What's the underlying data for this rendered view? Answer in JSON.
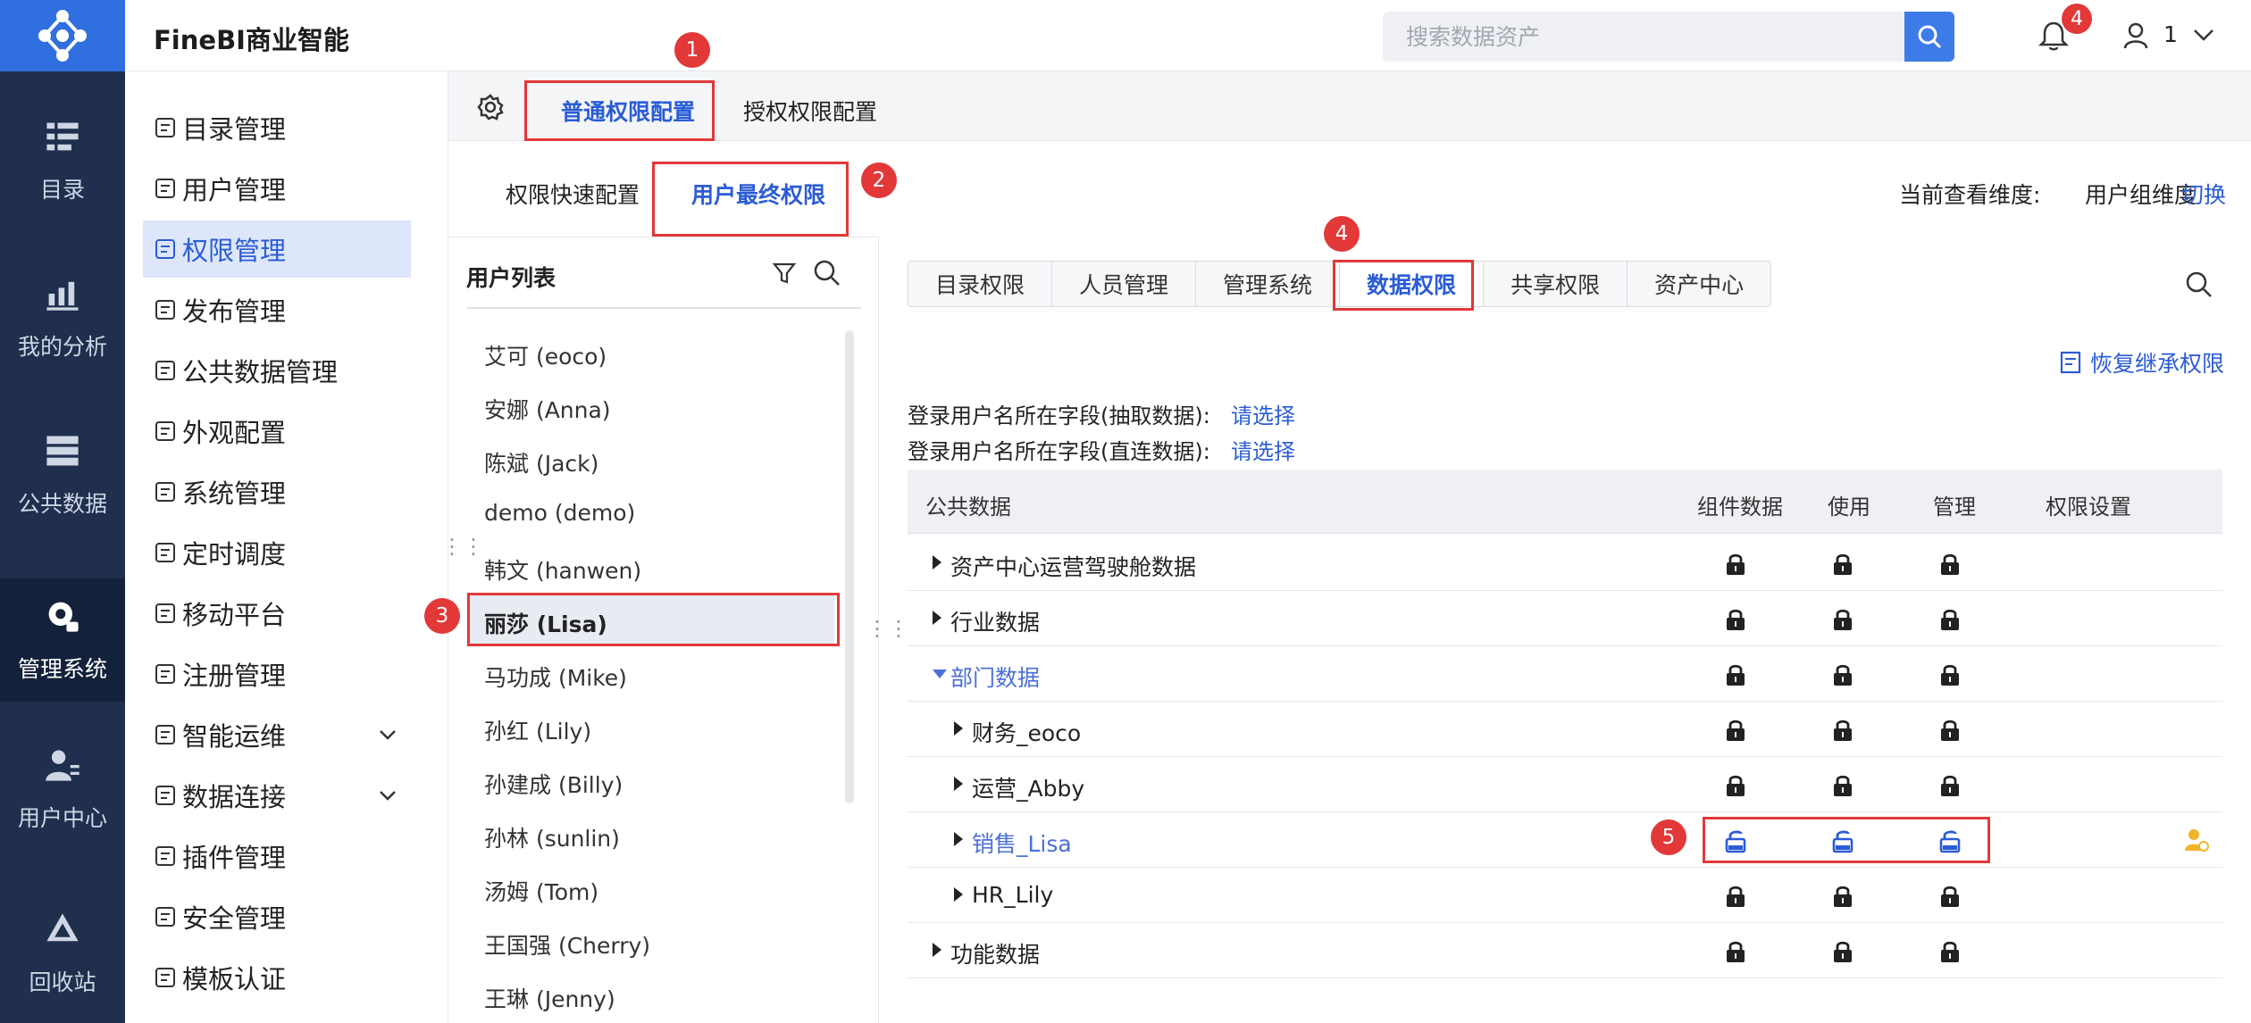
{
  "app": {
    "brand": "FineBI商业智能"
  },
  "rail": [
    {
      "label": "目录",
      "icon": "catalog-icon"
    },
    {
      "label": "我的分析",
      "icon": "analysis-icon"
    },
    {
      "label": "公共数据",
      "icon": "public-data-icon"
    },
    {
      "label": "管理系统",
      "icon": "management-icon",
      "active": true
    },
    {
      "label": "用户中心",
      "icon": "user-center-icon"
    },
    {
      "label": "回收站",
      "icon": "recycle-icon"
    }
  ],
  "topbar": {
    "search_placeholder": "搜索数据资产",
    "notification_count": "4",
    "user_name": "1"
  },
  "menu": [
    {
      "label": "目录管理"
    },
    {
      "label": "用户管理"
    },
    {
      "label": "权限管理",
      "active": true
    },
    {
      "label": "发布管理"
    },
    {
      "label": "公共数据管理"
    },
    {
      "label": "外观配置"
    },
    {
      "label": "系统管理"
    },
    {
      "label": "定时调度"
    },
    {
      "label": "移动平台"
    },
    {
      "label": "注册管理"
    },
    {
      "label": "智能运维",
      "expandable": true
    },
    {
      "label": "数据连接",
      "expandable": true
    },
    {
      "label": "插件管理"
    },
    {
      "label": "安全管理"
    },
    {
      "label": "模板认证"
    }
  ],
  "top_tabs": {
    "general": "普通权限配置",
    "authorize": "授权权限配置"
  },
  "sub_tabs": {
    "quick": "权限快速配置",
    "final": "用户最终权限"
  },
  "dimension": {
    "label": "当前查看维度:",
    "value": "用户组维度",
    "switch": "切换"
  },
  "user_list": {
    "title": "用户列表",
    "users": [
      "艾可 (eoco)",
      "安娜 (Anna)",
      "陈斌 (Jack)",
      "demo (demo)",
      "韩文 (hanwen)",
      "丽莎 (Lisa)",
      "马功成 (Mike)",
      "孙红 (Lily)",
      "孙建成 (Billy)",
      "孙林 (sunlin)",
      "汤姆 (Tom)",
      "王国强 (Cherry)",
      "王琳 (Jenny)"
    ],
    "selected_index": 5
  },
  "perm_tabs": [
    "目录权限",
    "人员管理",
    "管理系统",
    "数据权限",
    "共享权限",
    "资产中心"
  ],
  "restore_label": "恢复继承权限",
  "fields": [
    {
      "label": "登录用户名所在字段(抽取数据):",
      "value": "请选择"
    },
    {
      "label": "登录用户名所在字段(直连数据):",
      "value": "请选择"
    }
  ],
  "table": {
    "headers": [
      "公共数据",
      "组件数据",
      "使用",
      "管理",
      "权限设置"
    ],
    "rows": [
      {
        "name": "资产中心运营驾驶舱数据",
        "level": 0,
        "expanded": false,
        "locks": [
          "locked",
          "locked",
          "locked"
        ]
      },
      {
        "name": "行业数据",
        "level": 0,
        "expanded": false,
        "locks": [
          "locked",
          "locked",
          "locked"
        ]
      },
      {
        "name": "部门数据",
        "level": 0,
        "expanded": true,
        "highlight": true,
        "locks": [
          "locked",
          "locked",
          "locked"
        ]
      },
      {
        "name": "财务_eoco",
        "level": 1,
        "expanded": false,
        "locks": [
          "locked",
          "locked",
          "locked"
        ]
      },
      {
        "name": "运营_Abby",
        "level": 1,
        "expanded": false,
        "locks": [
          "locked",
          "locked",
          "locked"
        ]
      },
      {
        "name": "销售_Lisa",
        "level": 1,
        "expanded": false,
        "highlight": true,
        "locks": [
          "unlocked",
          "unlocked",
          "unlocked"
        ],
        "setting_icon": true
      },
      {
        "name": "HR_Lily",
        "level": 1,
        "expanded": false,
        "locks": [
          "locked",
          "locked",
          "locked"
        ]
      },
      {
        "name": "功能数据",
        "level": 0,
        "expanded": false,
        "locks": [
          "locked",
          "locked",
          "locked"
        ]
      }
    ]
  },
  "annotations": [
    "1",
    "2",
    "3",
    "4",
    "5"
  ],
  "colors": {
    "rail_bg": "#1f2f4d",
    "accent": "#2b5cd6",
    "annotation_red": "#e23838"
  }
}
